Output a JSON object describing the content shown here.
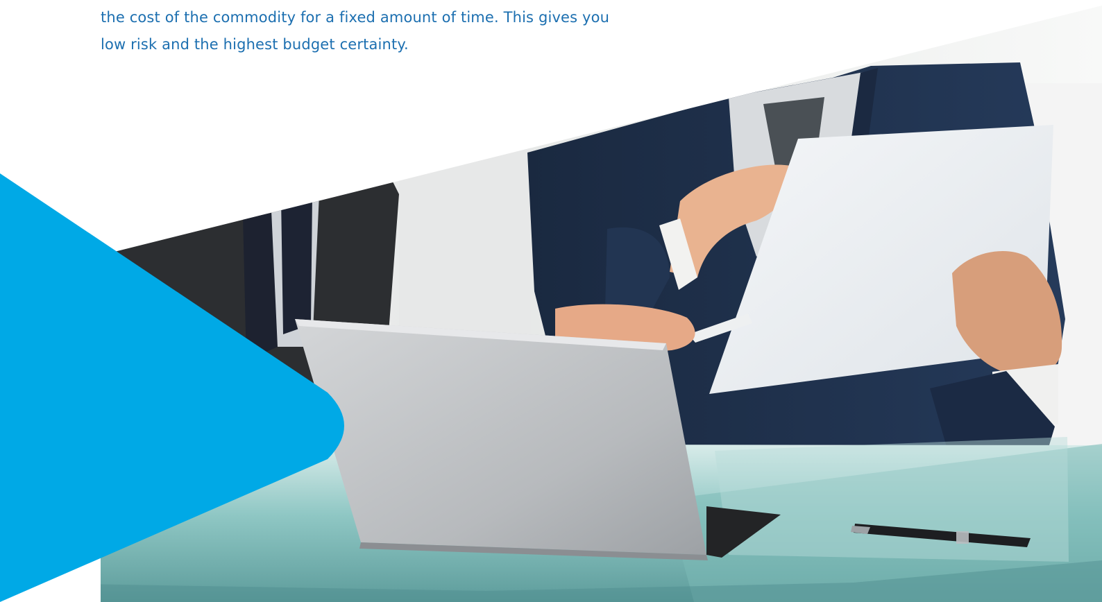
{
  "intro": {
    "line_1": "the cost of the commodity for a fixed amount of time. This gives you",
    "line_2": "low risk and the highest budget certainty."
  },
  "colors": {
    "text_blue": "#1c6fb0",
    "accent_blue": "#00a9e6",
    "background": "#ffffff"
  },
  "hero": {
    "image_name": "business-meeting-photo"
  }
}
